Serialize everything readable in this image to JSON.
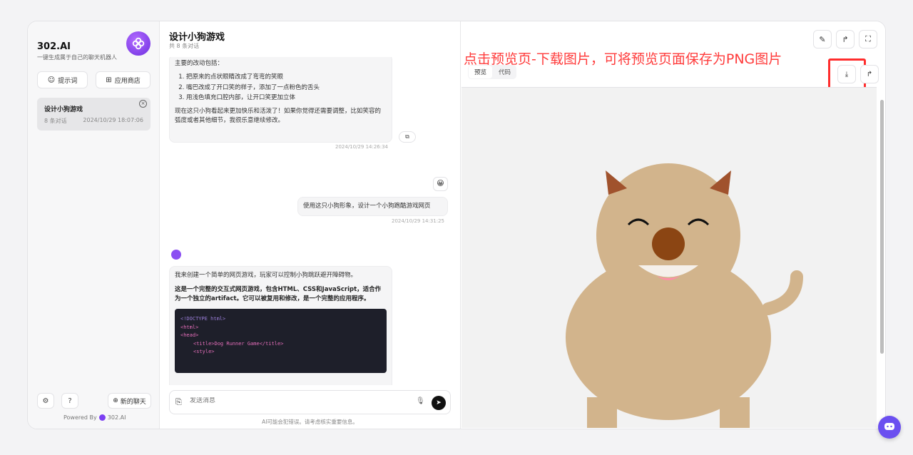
{
  "brand": {
    "title": "302.AI",
    "subtitle": "一键生成属于自己的聊天机器人"
  },
  "sidebar": {
    "prompt_btn": "提示词",
    "store_btn": "应用商店",
    "chat_item": {
      "title": "设计小狗游戏",
      "count": "8 条对话",
      "date": "2024/10/29 18:07:06"
    },
    "new_chat": "新的聊天",
    "powered_prefix": "Powered By",
    "powered_brand": "302.AI"
  },
  "chat": {
    "title": "设计小狗游戏",
    "count": "共 8 条对话",
    "msg1": {
      "heading": "主要的改动包括：",
      "items": [
        "把原来的点状眼睛改成了弯弯的笑眼",
        "嘴巴改成了开口笑的样子，添加了一点粉色的舌头",
        "用浅色填充口腔内部，让开口笑更加立体"
      ],
      "footer": "现在这只小狗看起来更加快乐和活泼了！如果你觉得还需要调整，比如笑容的弧度或者其他细节，我很乐意继续修改。",
      "time": "2024/10/29 14:26:34"
    },
    "msg2": {
      "text": "使用这只小狗形象，设计一个小狗跑酷游戏网页",
      "time": "2024/10/29 14:31:25"
    },
    "msg3": {
      "p1": "我来创建一个简单的网页游戏，玩家可以控制小狗跳跃避开障碍物。",
      "p2": "这是一个完整的交互式网页游戏，包含HTML、CSS和JavaScript，适合作为一个独立的artifact。它可以被复用和修改，是一个完整的应用程序。",
      "code": [
        "<!DOCTYPE html>",
        "<html>",
        "<head>",
        "<title>Dog Runner Game</title>",
        "<style>"
      ]
    },
    "input_placeholder": "发送消息",
    "disclaimer": "AI可能会犯错误。请考虑核实重要信息。"
  },
  "preview": {
    "annotation": "点击预览页-下载图片，可将预览页面保存为PNG图片",
    "tab_preview": "预览",
    "tab_code": "代码"
  },
  "colors": {
    "accent": "#7b3ff2",
    "annotation": "#ff3b3b",
    "dog_body": "#d2b48c",
    "dog_ears": "#a0522d",
    "dog_nose": "#8b4513"
  }
}
